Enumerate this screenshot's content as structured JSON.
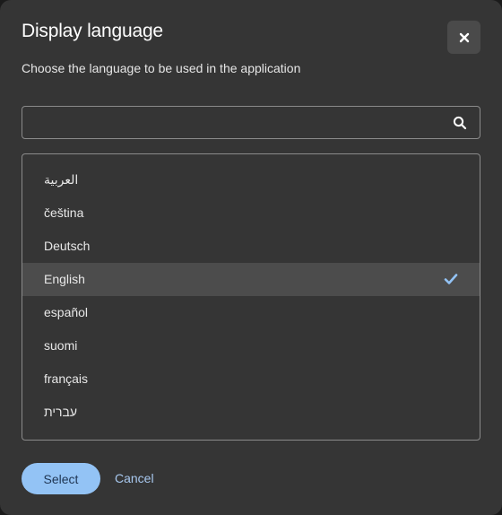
{
  "dialog": {
    "title": "Display language",
    "subtitle": "Choose the language to be used in the application",
    "close_icon": "close-icon"
  },
  "search": {
    "value": "",
    "placeholder": "",
    "icon": "search-icon"
  },
  "languages": {
    "items": [
      {
        "label": "العربية",
        "selected": false
      },
      {
        "label": "čeština",
        "selected": false
      },
      {
        "label": "Deutsch",
        "selected": false
      },
      {
        "label": "English",
        "selected": true
      },
      {
        "label": "español",
        "selected": false
      },
      {
        "label": "suomi",
        "selected": false
      },
      {
        "label": "français",
        "selected": false
      },
      {
        "label": "עברית",
        "selected": false
      }
    ],
    "check_icon": "check-icon"
  },
  "footer": {
    "select_label": "Select",
    "cancel_label": "Cancel"
  },
  "colors": {
    "dialog_bg": "#353535",
    "selected_bg": "#4c4c4c",
    "primary_button": "#93c3f5",
    "link": "#a8c8ef",
    "check": "#93c3f5"
  }
}
